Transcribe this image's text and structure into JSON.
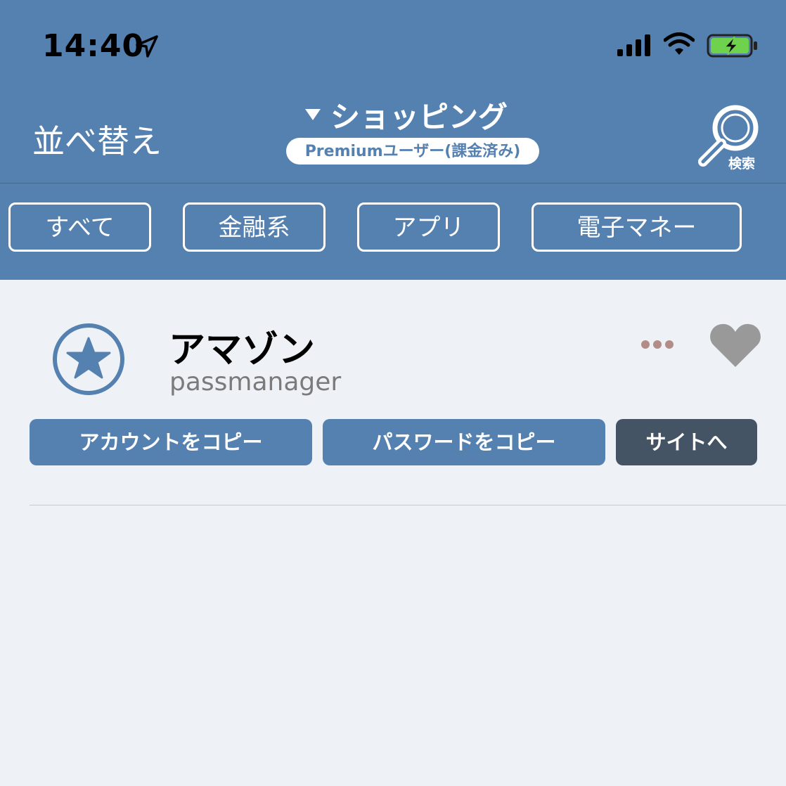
{
  "status_bar": {
    "time": "14:40",
    "icons": [
      "location-arrow-icon",
      "signal-icon",
      "wifi-icon",
      "battery-charging-icon"
    ]
  },
  "header": {
    "sort_label": "並べ替え",
    "title": "ショッピング",
    "badge": "Premiumユーザー(課金済み)",
    "search_label": "検索",
    "background": "#5581b0"
  },
  "tabs": [
    {
      "label": "すべて"
    },
    {
      "label": "金融系"
    },
    {
      "label": "アプリ"
    },
    {
      "label": "電子マネー"
    }
  ],
  "item": {
    "title": "アマゾン",
    "subtitle": "passmanager",
    "icon": "star-circle-icon",
    "favorite_icon": "heart-icon",
    "more_icon": "more-dots-icon",
    "actions": [
      {
        "label": "アカウントをコピー",
        "color": "#5581b0"
      },
      {
        "label": "パスワードをコピー",
        "color": "#5581b0"
      },
      {
        "label": "サイトへ",
        "color": "#445465"
      }
    ]
  }
}
